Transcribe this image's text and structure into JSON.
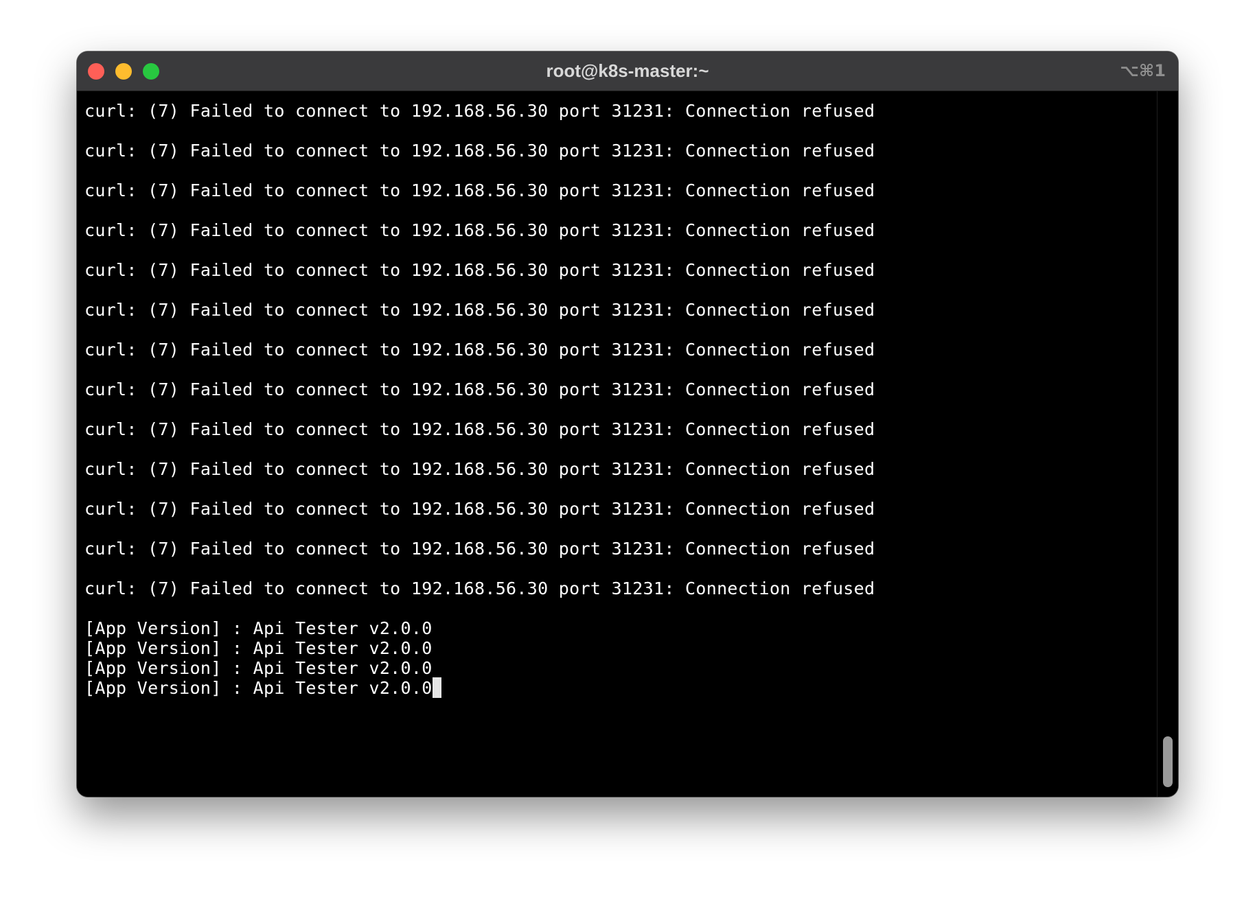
{
  "window": {
    "title": "root@k8s-master:~",
    "shortcut": "⌥⌘1"
  },
  "terminal": {
    "curl_lines": [
      "curl: (7) Failed to connect to 192.168.56.30 port 31231: Connection refused",
      "curl: (7) Failed to connect to 192.168.56.30 port 31231: Connection refused",
      "curl: (7) Failed to connect to 192.168.56.30 port 31231: Connection refused",
      "curl: (7) Failed to connect to 192.168.56.30 port 31231: Connection refused",
      "curl: (7) Failed to connect to 192.168.56.30 port 31231: Connection refused",
      "curl: (7) Failed to connect to 192.168.56.30 port 31231: Connection refused",
      "curl: (7) Failed to connect to 192.168.56.30 port 31231: Connection refused",
      "curl: (7) Failed to connect to 192.168.56.30 port 31231: Connection refused",
      "curl: (7) Failed to connect to 192.168.56.30 port 31231: Connection refused",
      "curl: (7) Failed to connect to 192.168.56.30 port 31231: Connection refused",
      "curl: (7) Failed to connect to 192.168.56.30 port 31231: Connection refused",
      "curl: (7) Failed to connect to 192.168.56.30 port 31231: Connection refused",
      "curl: (7) Failed to connect to 192.168.56.30 port 31231: Connection refused"
    ],
    "version_lines": [
      "[App Version] : Api Tester v2.0.0",
      "[App Version] : Api Tester v2.0.0",
      "[App Version] : Api Tester v2.0.0",
      "[App Version] : Api Tester v2.0.0"
    ]
  },
  "colors": {
    "close": "#fe5f57",
    "minimize": "#febc2e",
    "maximize": "#28c840",
    "background": "#000000",
    "text": "#ffffff"
  }
}
